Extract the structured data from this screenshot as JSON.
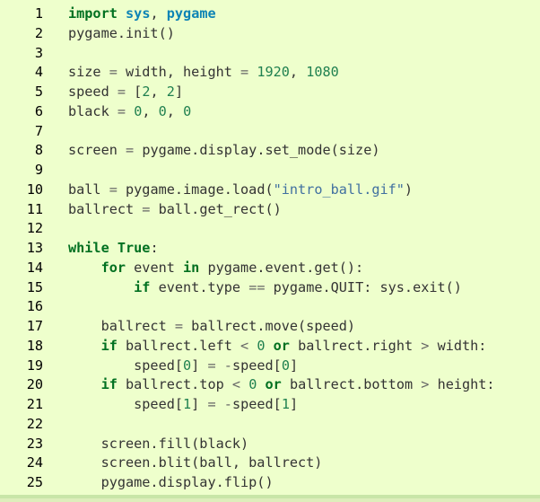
{
  "code_view": {
    "language": "python",
    "lines": [
      {
        "no": "1",
        "tokens": [
          {
            "t": "import",
            "c": "k"
          },
          {
            "t": " ",
            "c": "n"
          },
          {
            "t": "sys",
            "c": "nn"
          },
          {
            "t": ", ",
            "c": "p"
          },
          {
            "t": "pygame",
            "c": "nn"
          }
        ]
      },
      {
        "no": "2",
        "tokens": [
          {
            "t": "pygame.init()",
            "c": "n"
          }
        ]
      },
      {
        "no": "3",
        "tokens": []
      },
      {
        "no": "4",
        "tokens": [
          {
            "t": "size ",
            "c": "n"
          },
          {
            "t": "=",
            "c": "o"
          },
          {
            "t": " width, height ",
            "c": "n"
          },
          {
            "t": "=",
            "c": "o"
          },
          {
            "t": " ",
            "c": "n"
          },
          {
            "t": "1920",
            "c": "mi"
          },
          {
            "t": ", ",
            "c": "p"
          },
          {
            "t": "1080",
            "c": "mi"
          }
        ]
      },
      {
        "no": "5",
        "tokens": [
          {
            "t": "speed ",
            "c": "n"
          },
          {
            "t": "=",
            "c": "o"
          },
          {
            "t": " [",
            "c": "p"
          },
          {
            "t": "2",
            "c": "mi"
          },
          {
            "t": ", ",
            "c": "p"
          },
          {
            "t": "2",
            "c": "mi"
          },
          {
            "t": "]",
            "c": "p"
          }
        ]
      },
      {
        "no": "6",
        "tokens": [
          {
            "t": "black ",
            "c": "n"
          },
          {
            "t": "=",
            "c": "o"
          },
          {
            "t": " ",
            "c": "n"
          },
          {
            "t": "0",
            "c": "mi"
          },
          {
            "t": ", ",
            "c": "p"
          },
          {
            "t": "0",
            "c": "mi"
          },
          {
            "t": ", ",
            "c": "p"
          },
          {
            "t": "0",
            "c": "mi"
          }
        ]
      },
      {
        "no": "7",
        "tokens": []
      },
      {
        "no": "8",
        "tokens": [
          {
            "t": "screen ",
            "c": "n"
          },
          {
            "t": "=",
            "c": "o"
          },
          {
            "t": " pygame.display.set_mode(size)",
            "c": "n"
          }
        ]
      },
      {
        "no": "9",
        "tokens": []
      },
      {
        "no": "10",
        "tokens": [
          {
            "t": "ball ",
            "c": "n"
          },
          {
            "t": "=",
            "c": "o"
          },
          {
            "t": " pygame.image.load(",
            "c": "n"
          },
          {
            "t": "\"intro_ball.gif\"",
            "c": "s"
          },
          {
            "t": ")",
            "c": "p"
          }
        ]
      },
      {
        "no": "11",
        "tokens": [
          {
            "t": "ballrect ",
            "c": "n"
          },
          {
            "t": "=",
            "c": "o"
          },
          {
            "t": " ball.get_rect()",
            "c": "n"
          }
        ]
      },
      {
        "no": "12",
        "tokens": []
      },
      {
        "no": "13",
        "tokens": [
          {
            "t": "while",
            "c": "k"
          },
          {
            "t": " ",
            "c": "n"
          },
          {
            "t": "True",
            "c": "kc"
          },
          {
            "t": ":",
            "c": "p"
          }
        ]
      },
      {
        "no": "14",
        "tokens": [
          {
            "t": "    ",
            "c": "n"
          },
          {
            "t": "for",
            "c": "k"
          },
          {
            "t": " event ",
            "c": "n"
          },
          {
            "t": "in",
            "c": "ow"
          },
          {
            "t": " pygame.event.get():",
            "c": "n"
          }
        ]
      },
      {
        "no": "15",
        "tokens": [
          {
            "t": "        ",
            "c": "n"
          },
          {
            "t": "if",
            "c": "k"
          },
          {
            "t": " event.type ",
            "c": "n"
          },
          {
            "t": "==",
            "c": "o"
          },
          {
            "t": " pygame.QUIT: sys.exit()",
            "c": "n"
          }
        ]
      },
      {
        "no": "16",
        "tokens": []
      },
      {
        "no": "17",
        "tokens": [
          {
            "t": "    ballrect ",
            "c": "n"
          },
          {
            "t": "=",
            "c": "o"
          },
          {
            "t": " ballrect.move(speed)",
            "c": "n"
          }
        ]
      },
      {
        "no": "18",
        "tokens": [
          {
            "t": "    ",
            "c": "n"
          },
          {
            "t": "if",
            "c": "k"
          },
          {
            "t": " ballrect.left ",
            "c": "n"
          },
          {
            "t": "<",
            "c": "o"
          },
          {
            "t": " ",
            "c": "n"
          },
          {
            "t": "0",
            "c": "mi"
          },
          {
            "t": " ",
            "c": "n"
          },
          {
            "t": "or",
            "c": "ow"
          },
          {
            "t": " ballrect.right ",
            "c": "n"
          },
          {
            "t": ">",
            "c": "o"
          },
          {
            "t": " width:",
            "c": "n"
          }
        ]
      },
      {
        "no": "19",
        "tokens": [
          {
            "t": "        speed[",
            "c": "n"
          },
          {
            "t": "0",
            "c": "mi"
          },
          {
            "t": "] ",
            "c": "p"
          },
          {
            "t": "=",
            "c": "o"
          },
          {
            "t": " ",
            "c": "n"
          },
          {
            "t": "-",
            "c": "o"
          },
          {
            "t": "speed[",
            "c": "n"
          },
          {
            "t": "0",
            "c": "mi"
          },
          {
            "t": "]",
            "c": "p"
          }
        ]
      },
      {
        "no": "20",
        "tokens": [
          {
            "t": "    ",
            "c": "n"
          },
          {
            "t": "if",
            "c": "k"
          },
          {
            "t": " ballrect.top ",
            "c": "n"
          },
          {
            "t": "<",
            "c": "o"
          },
          {
            "t": " ",
            "c": "n"
          },
          {
            "t": "0",
            "c": "mi"
          },
          {
            "t": " ",
            "c": "n"
          },
          {
            "t": "or",
            "c": "ow"
          },
          {
            "t": " ballrect.bottom ",
            "c": "n"
          },
          {
            "t": ">",
            "c": "o"
          },
          {
            "t": " height:",
            "c": "n"
          }
        ]
      },
      {
        "no": "21",
        "tokens": [
          {
            "t": "        speed[",
            "c": "n"
          },
          {
            "t": "1",
            "c": "mi"
          },
          {
            "t": "] ",
            "c": "p"
          },
          {
            "t": "=",
            "c": "o"
          },
          {
            "t": " ",
            "c": "n"
          },
          {
            "t": "-",
            "c": "o"
          },
          {
            "t": "speed[",
            "c": "n"
          },
          {
            "t": "1",
            "c": "mi"
          },
          {
            "t": "]",
            "c": "p"
          }
        ]
      },
      {
        "no": "22",
        "tokens": []
      },
      {
        "no": "23",
        "tokens": [
          {
            "t": "    screen.fill(black)",
            "c": "n"
          }
        ]
      },
      {
        "no": "24",
        "tokens": [
          {
            "t": "    screen.blit(ball, ballrect)",
            "c": "n"
          }
        ]
      },
      {
        "no": "25",
        "tokens": [
          {
            "t": "    pygame.display.flip()",
            "c": "n"
          }
        ]
      }
    ]
  }
}
